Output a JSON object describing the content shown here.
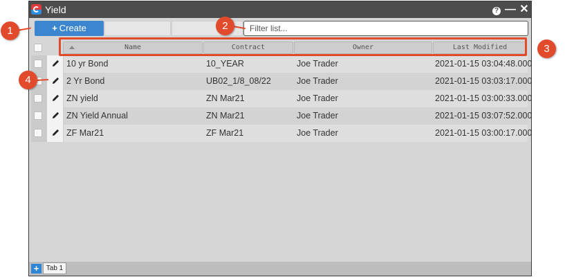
{
  "window": {
    "title": "Yield"
  },
  "titlebar": {
    "help_glyph": "?",
    "minimize_glyph": "—",
    "close_glyph": "✕"
  },
  "toolbar": {
    "create_plus": "+",
    "create_label": "Create",
    "filter_placeholder": "Filter list..."
  },
  "grid": {
    "columns": [
      "Name",
      "Contract",
      "Owner",
      "Last Modified"
    ],
    "rows": [
      {
        "name": "10 yr Bond",
        "contract": "10_YEAR",
        "owner": "Joe Trader",
        "modified": "2021-01-15 03:04:48.000"
      },
      {
        "name": "2 Yr Bond",
        "contract": "UB02_1/8_08/22",
        "owner": "Joe Trader",
        "modified": "2021-01-15 03:03:17.000"
      },
      {
        "name": "ZN yield",
        "contract": "ZN Mar21",
        "owner": "Joe Trader",
        "modified": "2021-01-15 03:00:33.000"
      },
      {
        "name": "ZN Yield Annual",
        "contract": "ZN Mar21",
        "owner": "Joe Trader",
        "modified": "2021-01-15 03:07:52.000"
      },
      {
        "name": "ZF Mar21",
        "contract": "ZF Mar21",
        "owner": "Joe Trader",
        "modified": "2021-01-15 03:00:17.000"
      }
    ]
  },
  "tabs": {
    "add_glyph": "+",
    "items": [
      "Tab 1"
    ]
  },
  "callouts": [
    "1",
    "2",
    "3",
    "4"
  ],
  "colors": {
    "accent": "#3b86cf",
    "callout": "#e24a2c",
    "titlebar": "#4d4d4d"
  },
  "icons": [
    "app-logo-icon",
    "help-icon",
    "minimize-icon",
    "close-icon",
    "pencil-icon",
    "sort-up-icon",
    "plus-icon"
  ]
}
